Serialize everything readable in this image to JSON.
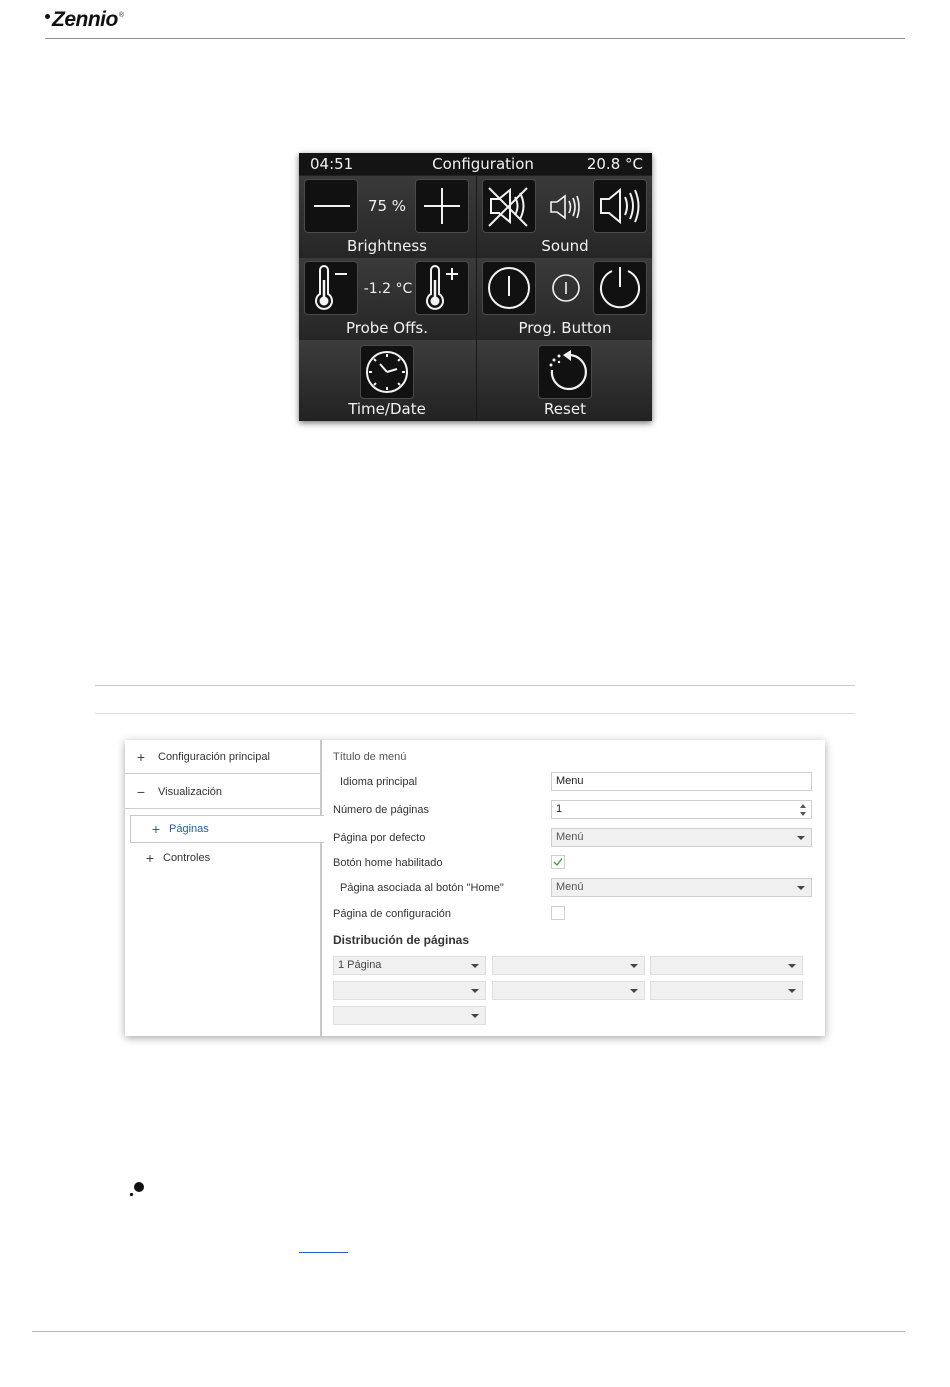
{
  "header": {
    "logo_text": "Zennio",
    "logo_mark": "®"
  },
  "device_screen": {
    "time": "04:51",
    "title": "Configuration",
    "temperature": "20.8 °C",
    "cells": [
      {
        "label": "Brightness",
        "value": "75 %",
        "left_icon": "minus-icon",
        "right_icon": "plus-icon"
      },
      {
        "label": "Sound",
        "left_icon": "mute-speaker-icon",
        "center_icon": "speaker-low-icon",
        "right_icon": "speaker-high-icon"
      },
      {
        "label": "Probe Offs.",
        "value": "-1.2 °C",
        "left_icon": "thermometer-minus-icon",
        "right_icon": "thermometer-plus-icon"
      },
      {
        "label": "Prog. Button",
        "left_icon": "prog-off-icon",
        "center_icon": "prog-led-icon",
        "right_icon": "prog-on-icon"
      },
      {
        "label": "Time/Date",
        "icon": "clock-icon"
      },
      {
        "label": "Reset",
        "icon": "reset-icon"
      }
    ]
  },
  "ets_panel": {
    "tree": [
      {
        "sign": "+",
        "label": "Configuración principal"
      },
      {
        "sign": "−",
        "label": "Visualización"
      },
      {
        "sign": "+",
        "label": "Páginas",
        "selected": true
      },
      {
        "sign": "+",
        "label": "Controles"
      }
    ],
    "params": {
      "menu_title": "Título de menú",
      "language_label": "Idioma principal",
      "language_value": "Menu",
      "pages_count_label": "Número de páginas",
      "pages_count_value": "1",
      "default_page_label": "Página por defecto",
      "default_page_value": "Menú",
      "home_enabled_label": "Botón home habilitado",
      "home_enabled_checked": true,
      "home_page_label": "Página asociada al botón \"Home\"",
      "home_page_value": "Menú",
      "config_page_label": "Página de configuración",
      "config_page_checked": false
    },
    "distribution": {
      "title": "Distribución de páginas",
      "selects": [
        "1 Página",
        "",
        "",
        "",
        "",
        "",
        ""
      ]
    }
  }
}
